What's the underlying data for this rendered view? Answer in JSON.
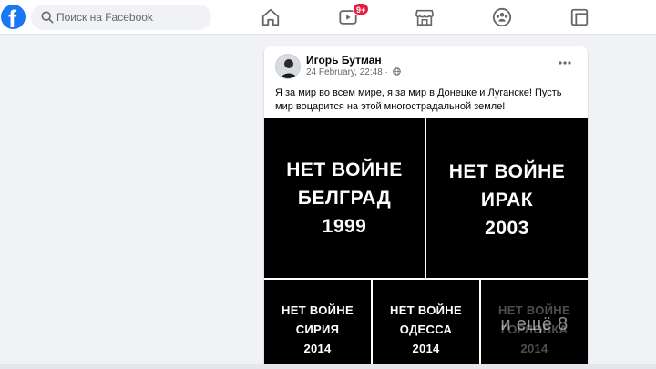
{
  "search": {
    "placeholder": "Поиск на Facebook"
  },
  "nav": {
    "watch_badge": "9+"
  },
  "post": {
    "author": "Игорь Бутман",
    "timestamp": "24 February, 22:48 ·",
    "text": "Я за мир во всем мире, я за мир в Донецке и Луганске! Пусть мир воцарится на этой многострадальной земле!",
    "tiles": [
      {
        "line1": "НЕТ ВОЙНЕ",
        "line2": "БЕЛГРАД",
        "line3": "1999"
      },
      {
        "line1": "НЕТ ВОЙНЕ",
        "line2": "ИРАК",
        "line3": "2003"
      },
      {
        "line1": "НЕТ ВОЙНЕ",
        "line2": "СИРИЯ",
        "line3": "2014"
      },
      {
        "line1": "НЕТ ВОЙНЕ",
        "line2": "ОДЕССА",
        "line3": "2014"
      },
      {
        "line1": "НЕТ ВОЙНЕ",
        "line2": "ГОРЛОВКА",
        "line3": "2014"
      }
    ],
    "more_photos_label": "и ещё 8"
  },
  "colors": {
    "brand": "#1877f2",
    "badge": "#e41e3f",
    "background": "#f0f2f5"
  }
}
